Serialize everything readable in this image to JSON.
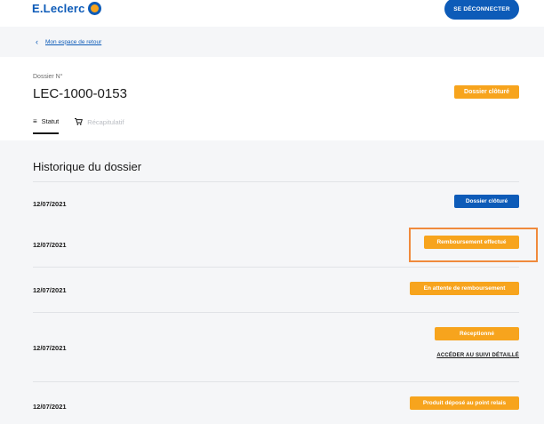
{
  "header": {
    "logo_text": "E.Leclerc",
    "logout_label": "SE DÉCONNECTER"
  },
  "breadcrumb": {
    "link": "Mon espace de retour"
  },
  "dossier": {
    "label": "Dossier N°",
    "id": "LEC-1000-0153",
    "status": "Dossier clôturé"
  },
  "tabs": [
    {
      "label": "Statut",
      "icon": "list-icon",
      "active": true
    },
    {
      "label": "Récapitulatif",
      "icon": "cart-icon",
      "active": false
    }
  ],
  "history": {
    "title": "Historique du dossier",
    "rows": [
      {
        "date": "12/07/2021",
        "status": "Dossier clôturé",
        "color": "blue"
      },
      {
        "date": "12/07/2021",
        "status": "Remboursement effectué",
        "color": "orange",
        "highlighted": true
      },
      {
        "date": "12/07/2021",
        "status": "En attente de remboursement",
        "color": "orange"
      },
      {
        "date": "12/07/2021",
        "status": "Réceptionné",
        "color": "orange",
        "link": "ACCÉDER AU SUIVI DÉTAILLÉ"
      },
      {
        "date": "12/07/2021",
        "status": "Produit déposé au point relais",
        "color": "orange"
      }
    ]
  },
  "colors": {
    "brand_blue": "#0d5bb8",
    "accent_orange": "#f7a41d",
    "highlight": "#f08a3c"
  }
}
